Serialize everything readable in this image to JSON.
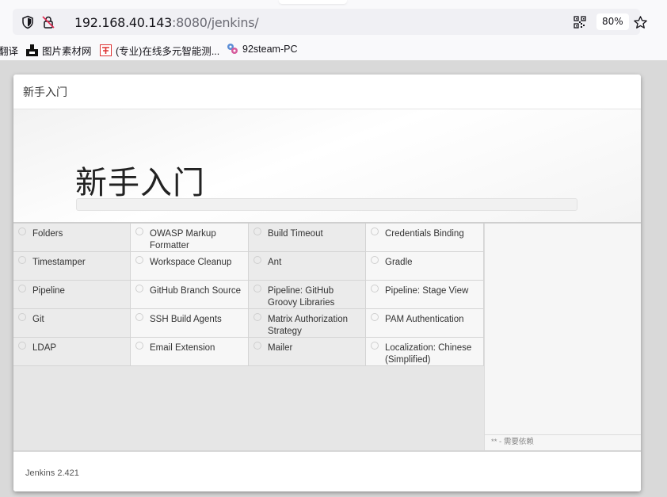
{
  "browser": {
    "url_host": "192.168.40.143",
    "url_rest": ":8080/jenkins/",
    "zoom": "80%",
    "bookmarks": [
      {
        "label": "翻译",
        "icon": "none"
      },
      {
        "label": "图片素材网",
        "icon": "image-site-icon"
      },
      {
        "label": "(专业)在线多元智能测...",
        "icon": "test-site-icon"
      },
      {
        "label": "92steam-PC",
        "icon": "steam-site-icon"
      }
    ]
  },
  "dialog": {
    "header_title": "新手入门",
    "hero_title": "新手入门",
    "progress_fraction": 0,
    "plugins": [
      "Folders",
      "OWASP Markup Formatter",
      "Build Timeout",
      "Credentials Binding",
      "Timestamper",
      "Workspace Cleanup",
      "Ant",
      "Gradle",
      "Pipeline",
      "GitHub Branch Source",
      "Pipeline: GitHub Groovy Libraries",
      "Pipeline: Stage View",
      "Git",
      "SSH Build Agents",
      "Matrix Authorization Strategy",
      "PAM Authentication",
      "LDAP",
      "Email Extension",
      "Mailer",
      "Localization: Chinese (Simplified)"
    ],
    "dependency_note": "** - 需要依赖",
    "footer_version": "Jenkins 2.421"
  },
  "colors": {
    "accent": "#8bc34a",
    "page_bg": "#d9d9d9"
  }
}
